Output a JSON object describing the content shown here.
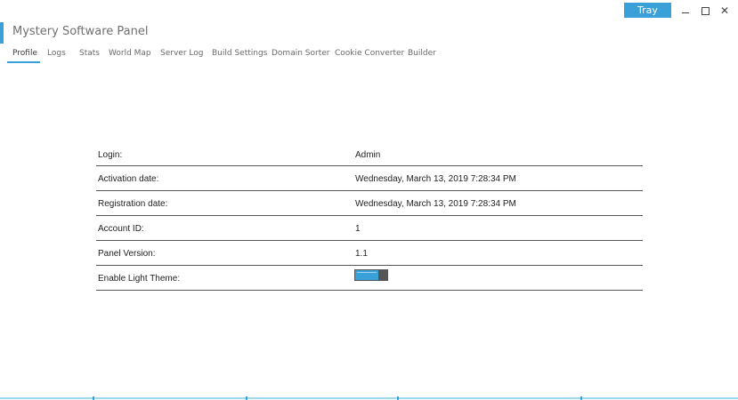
{
  "window": {
    "title": "Mystery Software Panel",
    "tray_label": "Tray",
    "minimize_icon": "minimize-icon",
    "maximize_icon": "maximize-icon",
    "close_icon": "close-icon",
    "close_glyph": "✕"
  },
  "tabs": [
    {
      "label": "Profile",
      "active": true
    },
    {
      "label": "Logs"
    },
    {
      "label": "Stats"
    },
    {
      "label": "World Map"
    },
    {
      "label": "Server Log"
    },
    {
      "label": "Build Settings"
    },
    {
      "label": "Domain Sorter"
    },
    {
      "label": "Cookie Converter"
    },
    {
      "label": "Builder"
    }
  ],
  "profile": {
    "rows": [
      {
        "label": "Login:",
        "value": "Admin"
      },
      {
        "label": "Activation date:",
        "value": "Wednesday, March 13, 2019 7:28:34 PM"
      },
      {
        "label": "Registration date:",
        "value": "Wednesday, March 13, 2019 7:28:34 PM"
      },
      {
        "label": "Account ID:",
        "value": "1"
      },
      {
        "label": "Panel Version:",
        "value": "1.1"
      },
      {
        "label": "Enable Light Theme:",
        "value": ""
      }
    ],
    "light_theme_enabled": true
  },
  "colors": {
    "accent": "#3aa0d8",
    "toggle_knob": "#555555"
  }
}
